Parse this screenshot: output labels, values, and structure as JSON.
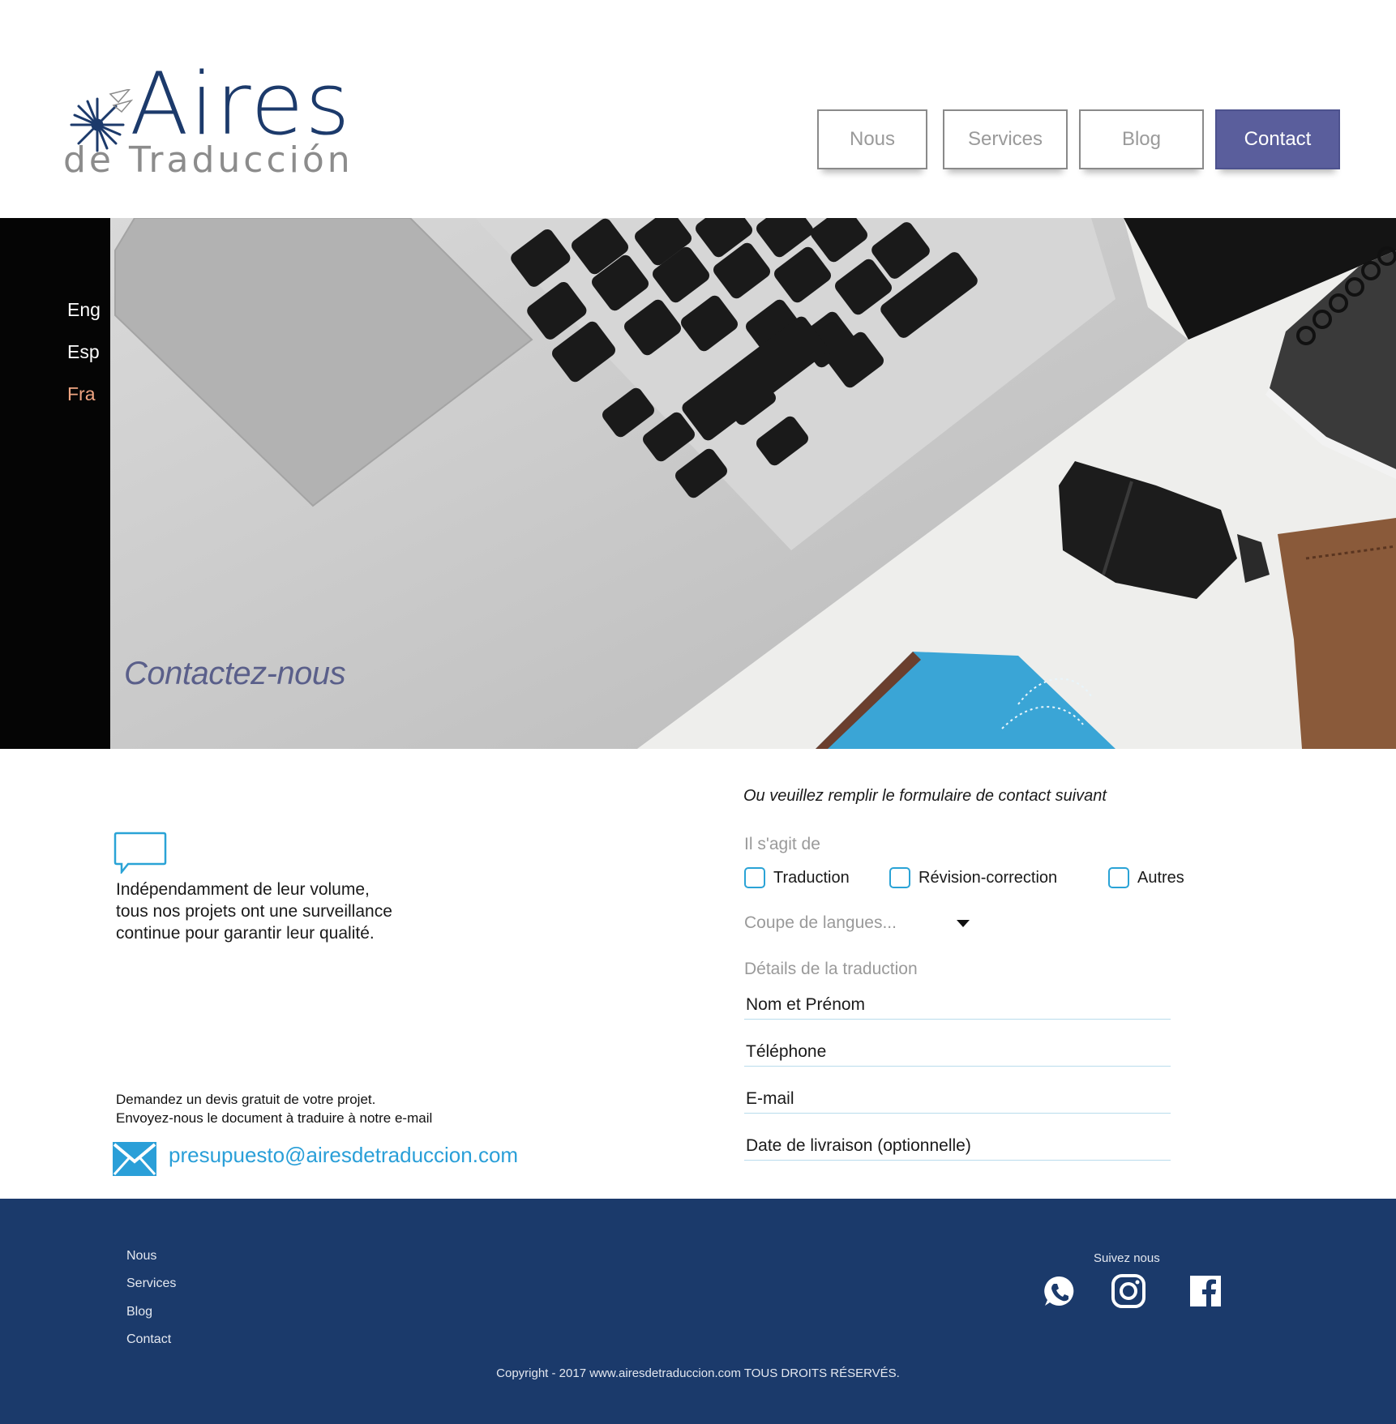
{
  "brand": {
    "name_line1": "Aires",
    "name_line2": "de Traducción",
    "primary_color": "#1c3a6b",
    "accent_color": "#5a5e9c"
  },
  "nav": {
    "items": [
      {
        "label": "Nous",
        "active": false
      },
      {
        "label": "Services",
        "active": false
      },
      {
        "label": "Blog",
        "active": false
      },
      {
        "label": "Contact",
        "active": true
      }
    ]
  },
  "languages": [
    {
      "label": "Eng",
      "active": false
    },
    {
      "label": "Esp",
      "active": false
    },
    {
      "label": "Fra",
      "active": true
    }
  ],
  "hero": {
    "title": "Contactez-nous"
  },
  "info": {
    "lead_lines": [
      "Indépendamment de leur volume,",
      "tous nos projets ont une surveillance",
      "continue pour garantir leur qualité."
    ],
    "quote_lines": [
      "Demandez un devis gratuit de votre projet.",
      "Envoyez-nous le document à traduire à notre e-mail"
    ],
    "email": "presupuesto@airesdetraduccion.com"
  },
  "form": {
    "intro": "Ou veuillez remplir le formulaire de contact suivant",
    "type_label": "Il s'agit de",
    "options": [
      "Traduction",
      "Révision-correction",
      "Autres"
    ],
    "language_pair_placeholder": "Coupe de langues...",
    "details_label": "Détails de la traduction",
    "fields": [
      {
        "placeholder": "Nom et Prénom"
      },
      {
        "placeholder": "Téléphone"
      },
      {
        "placeholder": "E-mail"
      },
      {
        "placeholder": "Date de livraison (optionnelle)"
      }
    ]
  },
  "footer": {
    "links": [
      "Nous",
      "Services",
      "Blog",
      "Contact"
    ],
    "follow_label": "Suivez nous",
    "social": [
      "whatsapp-icon",
      "instagram-icon",
      "facebook-icon"
    ],
    "copyright": "Copyright - 2017 www.airesdetraduccion.com TOUS DROITS RÉSERVÉS."
  }
}
